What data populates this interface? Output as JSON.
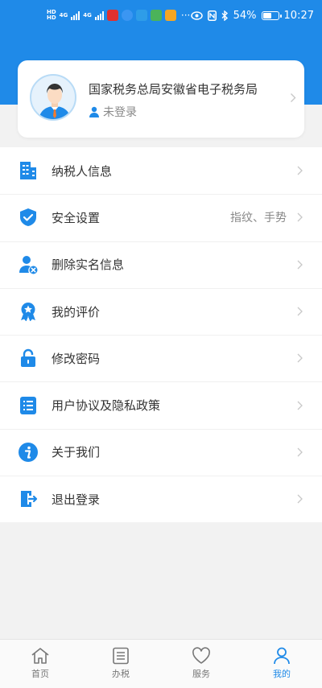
{
  "colors": {
    "accent": "#1f8ae8",
    "background": "#f2f2f2",
    "text": "#333333",
    "muted": "#888888"
  },
  "status_bar": {
    "left_items": [
      "HD",
      "4G",
      "4G",
      "HD"
    ],
    "battery": "54%",
    "time": "10:27"
  },
  "profile": {
    "name": "国家税务总局安徽省电子税务局",
    "login_status": "未登录"
  },
  "menu": {
    "items": [
      {
        "label": "纳税人信息",
        "value": "",
        "icon": "building-icon"
      },
      {
        "label": "安全设置",
        "value": "指纹、手势",
        "icon": "shield-check-icon"
      },
      {
        "label": "删除实名信息",
        "value": "",
        "icon": "user-remove-icon"
      },
      {
        "label": "我的评价",
        "value": "",
        "icon": "rating-medal-icon"
      },
      {
        "label": "修改密码",
        "value": "",
        "icon": "unlock-icon"
      },
      {
        "label": "用户协议及隐私政策",
        "value": "",
        "icon": "list-document-icon"
      },
      {
        "label": "关于我们",
        "value": "",
        "icon": "info-icon"
      },
      {
        "label": "退出登录",
        "value": "",
        "icon": "logout-door-icon"
      }
    ]
  },
  "tabbar": {
    "tabs": [
      {
        "label": "首页",
        "icon": "home-icon",
        "active": false
      },
      {
        "label": "办税",
        "icon": "document-list-icon",
        "active": false
      },
      {
        "label": "服务",
        "icon": "heart-icon",
        "active": false
      },
      {
        "label": "我的",
        "icon": "person-icon",
        "active": true
      }
    ]
  }
}
